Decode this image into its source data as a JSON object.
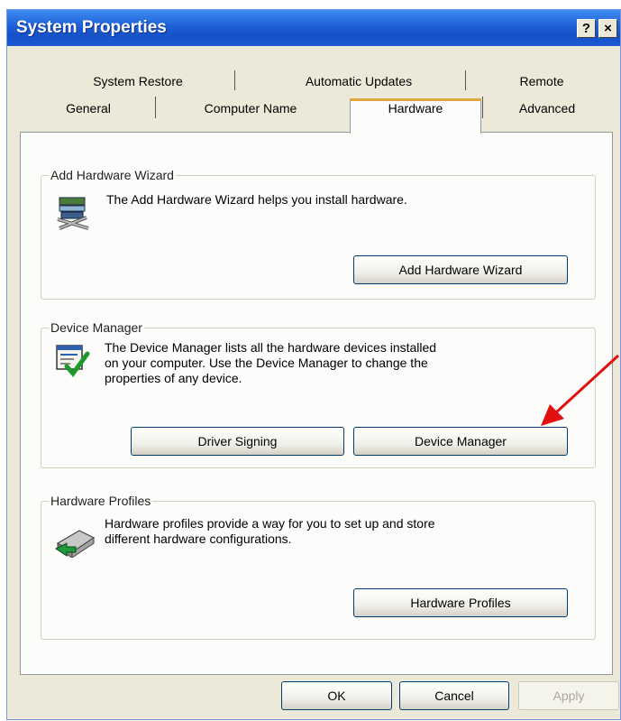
{
  "window": {
    "title": "System Properties"
  },
  "title_buttons": {
    "help": "?",
    "close": "×"
  },
  "tabs": {
    "row1": [
      "System Restore",
      "Automatic Updates",
      "Remote"
    ],
    "row2": [
      "General",
      "Computer Name",
      "Hardware",
      "Advanced"
    ],
    "active": "Hardware"
  },
  "groups": {
    "add_hardware": {
      "legend": "Add Hardware Wizard",
      "description": "The Add Hardware Wizard helps you install hardware.",
      "button": "Add Hardware Wizard",
      "icon": "add-hardware-icon"
    },
    "device_manager": {
      "legend": "Device Manager",
      "description_lines": [
        "The Device Manager lists all the hardware devices installed",
        "on your computer. Use the Device Manager to change the",
        "properties of any device."
      ],
      "button_driver": "Driver Signing",
      "button_device": "Device Manager",
      "icon": "device-manager-icon"
    },
    "profiles": {
      "legend": "Hardware Profiles",
      "description_lines": [
        "Hardware profiles provide a way for you to set up and store",
        "different hardware configurations."
      ],
      "button": "Hardware Profiles",
      "icon": "hardware-profiles-icon"
    }
  },
  "footer": {
    "ok": "OK",
    "cancel": "Cancel",
    "apply": "Apply"
  },
  "colors": {
    "title_bar": "#1d5fd6",
    "dialog_bg": "#ece9d8",
    "annotation_arrow": "#e01010",
    "active_tab_highlight": "#e0a640"
  }
}
